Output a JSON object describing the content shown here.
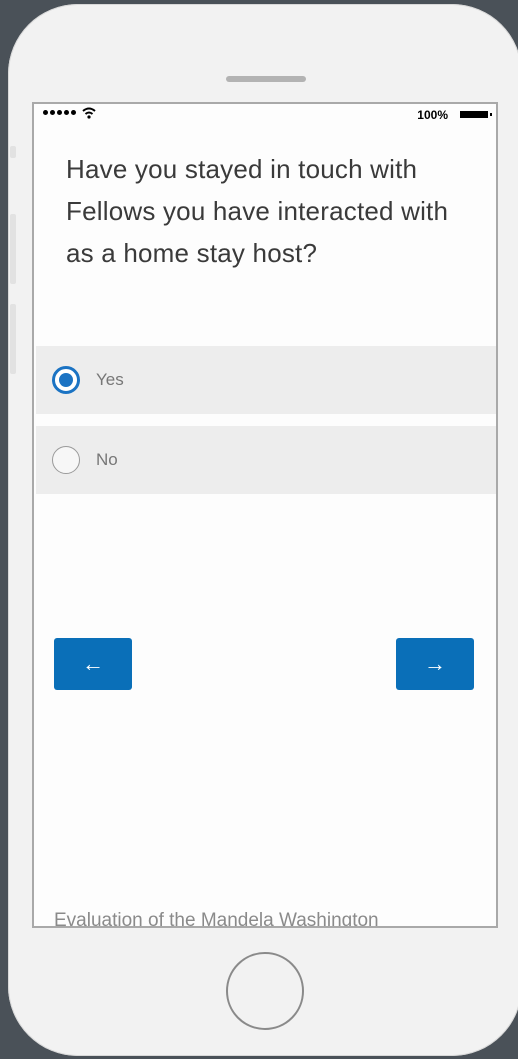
{
  "status_bar": {
    "battery_percent": "100%"
  },
  "survey": {
    "question": "Have you stayed in touch with Fellows you have interacted with as a home stay host?",
    "options": [
      {
        "label": "Yes",
        "selected": true
      },
      {
        "label": "No",
        "selected": false
      }
    ],
    "nav": {
      "back_label": "←",
      "next_label": "→"
    },
    "footer_text": "Evaluation of the Mandela Washington"
  },
  "colors": {
    "accent": "#1b73c3",
    "button": "#0a6fb8"
  }
}
